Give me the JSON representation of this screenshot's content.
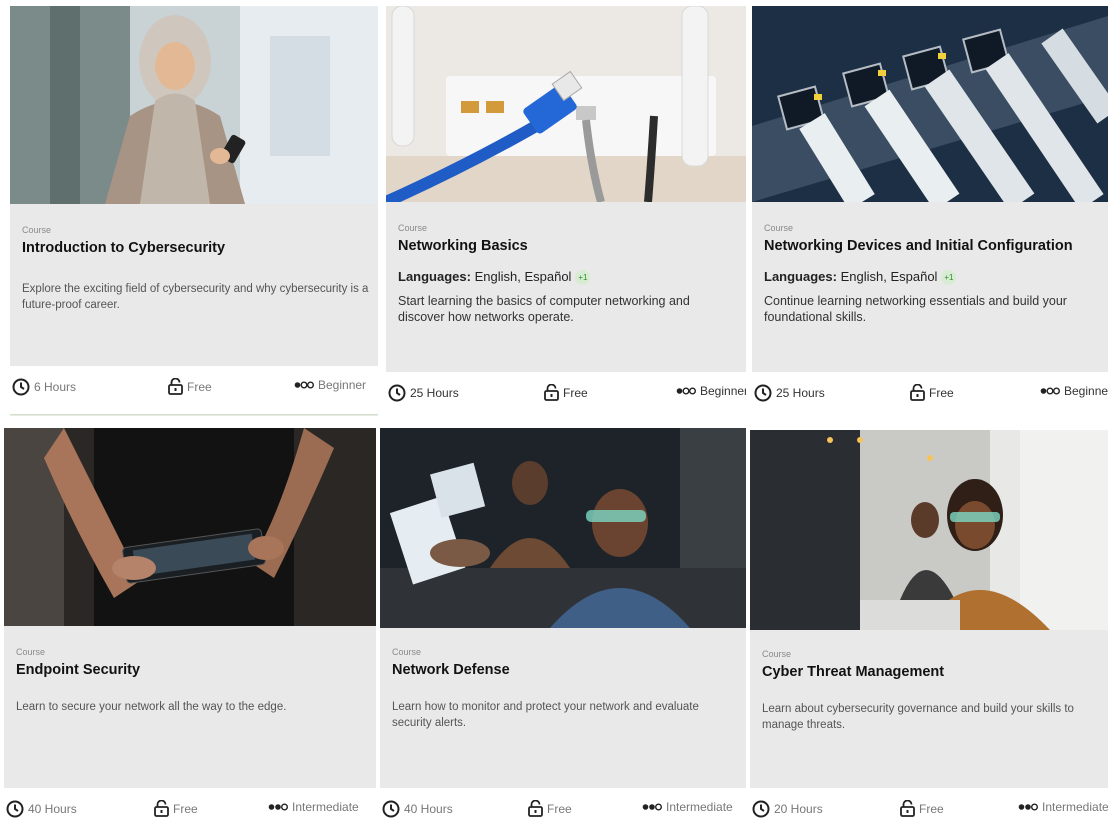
{
  "cards": [
    {
      "kind": "Course",
      "title": "Introduction to Cybersecurity",
      "languages_label": "",
      "languages": "",
      "more": "",
      "description": "Explore the exciting field of cybersecurity and why cybersecurity is a future-proof career.",
      "hours": "6 Hours",
      "price": "Free",
      "level": "Beginner",
      "image": "woman-phone-photo"
    },
    {
      "kind": "Course",
      "title": "Networking Basics",
      "languages_label": "Languages:",
      "languages": "English, Español",
      "more": "+1",
      "description": "Start learning the basics of computer networking and discover how networks operate.",
      "hours": "25 Hours",
      "price": "Free",
      "level": "Beginner",
      "image": "router-cable-photo"
    },
    {
      "kind": "Course",
      "title": "Networking Devices and Initial Configuration",
      "languages_label": "Languages:",
      "languages": "English, Español",
      "more": "+1",
      "description": "Continue learning networking essentials and build your foundational skills.",
      "hours": "25 Hours",
      "price": "Free",
      "level": "Beginner",
      "image": "switch-ports-photo"
    },
    {
      "kind": "Course",
      "title": "Endpoint Security",
      "languages_label": "",
      "languages": "",
      "more": "",
      "description": "Learn to secure your network all the way to the edge.",
      "hours": "40 Hours",
      "price": "Free",
      "level": "Intermediate",
      "image": "hands-tablet-photo"
    },
    {
      "kind": "Course",
      "title": "Network Defense",
      "languages_label": "",
      "languages": "",
      "more": "",
      "description": "Learn how to monitor and protect your network and evaluate security alerts.",
      "hours": "40 Hours",
      "price": "Free",
      "level": "Intermediate",
      "image": "office-workers-photo"
    },
    {
      "kind": "Course",
      "title": "Cyber Threat Management",
      "languages_label": "",
      "languages": "",
      "more": "",
      "description": "Learn about cybersecurity governance and build your skills to manage threats.",
      "hours": "20 Hours",
      "price": "Free",
      "level": "Intermediate",
      "image": "woman-office-photo"
    }
  ],
  "colors": {
    "card_bg": "#e9e9e9",
    "accent_green": "#2e8b2e",
    "divider_green": "#cfe4c6"
  },
  "icons": {
    "duration": "clock-icon",
    "price": "unlock-icon",
    "level": "level-dots-icon"
  }
}
